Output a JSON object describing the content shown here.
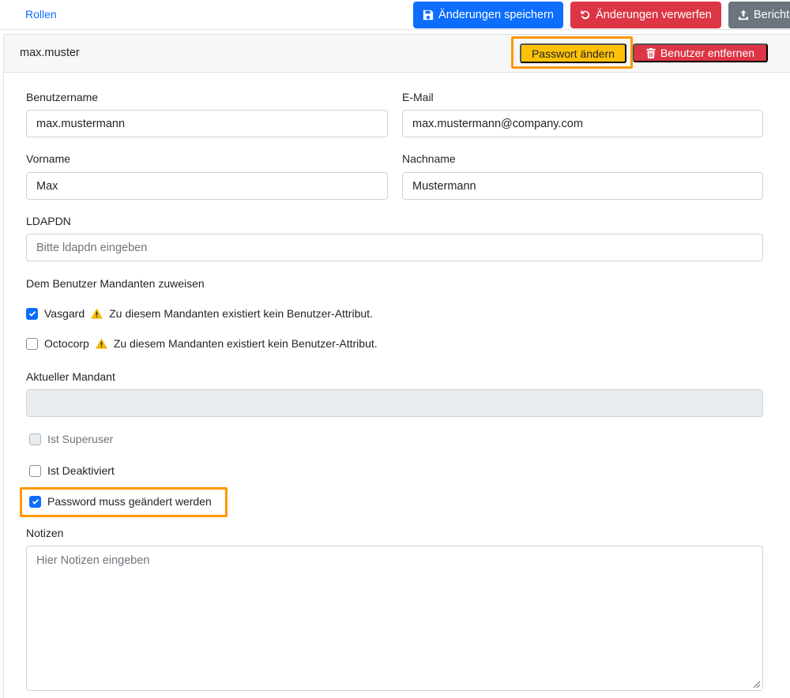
{
  "topbar": {
    "roles_link": "Rollen",
    "save_label": "Änderungen speichern",
    "discard_label": "Änderungen verwerfen",
    "report_label": "Bericht"
  },
  "card": {
    "title": "max.muster",
    "change_password_label": "Passwort ändern",
    "remove_user_label": "Benutzer entfernen"
  },
  "form": {
    "username": {
      "label": "Benutzername",
      "value": "max.mustermann"
    },
    "email": {
      "label": "E-Mail",
      "value": "max.mustermann@company.com"
    },
    "firstname": {
      "label": "Vorname",
      "value": "Max"
    },
    "lastname": {
      "label": "Nachname",
      "value": "Mustermann"
    },
    "ldapdn": {
      "label": "LDAPDN",
      "value": "",
      "placeholder": "Bitte ldapdn eingeben"
    },
    "tenants_label": "Dem Benutzer Mandanten zuweisen",
    "tenants": [
      {
        "name": "Vasgard",
        "checked": true,
        "warning": "Zu diesem Mandanten existiert kein Benutzer-Attribut."
      },
      {
        "name": "Octocorp",
        "checked": false,
        "warning": "Zu diesem Mandanten existiert kein Benutzer-Attribut."
      }
    ],
    "current_tenant": {
      "label": "Aktueller Mandant",
      "value": ""
    },
    "superuser": {
      "label": "Ist Superuser",
      "checked": false,
      "disabled": true
    },
    "deactivated": {
      "label": "Ist Deaktiviert",
      "checked": false
    },
    "password_must_change": {
      "label": "Password muss geändert werden",
      "checked": true
    },
    "notes": {
      "label": "Notizen",
      "placeholder": "Hier Notizen eingeben"
    }
  },
  "colors": {
    "primary": "#0d6efd",
    "danger": "#dc3545",
    "secondary": "#6c757d",
    "warning": "#ffc107",
    "highlight": "#ff9800"
  },
  "icons": {
    "save": "floppy-disk-icon",
    "discard": "undo-icon",
    "report": "upload-icon",
    "remove": "trash-icon",
    "warning": "warning-triangle-icon",
    "check": "checkmark-icon"
  }
}
